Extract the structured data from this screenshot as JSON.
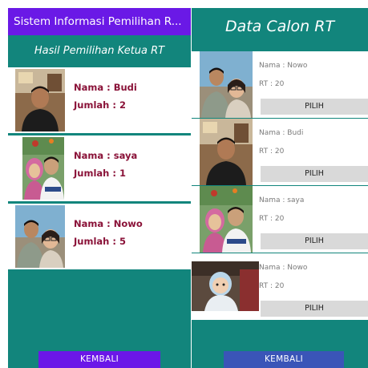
{
  "left_screen": {
    "appbar_title": "Sistem Informasi Pemilihan R...",
    "subtitle": "Hasil Pemilihan Ketua RT",
    "results": [
      {
        "nama": "Nama : Budi",
        "jumlah": "Jumlah : 2"
      },
      {
        "nama": "Nama : saya",
        "jumlah": "Jumlah : 1"
      },
      {
        "nama": "Nama : Nowo",
        "jumlah": "Jumlah : 5"
      }
    ],
    "back_button": "KEMBALI"
  },
  "right_screen": {
    "title": "Data Calon RT",
    "candidates": [
      {
        "nama": "Nama : Nowo",
        "rt": "RT : 20",
        "button": "PILIH"
      },
      {
        "nama": "Nama : Budi",
        "rt": "RT : 20",
        "button": "PILIH"
      },
      {
        "nama": "Nama : saya",
        "rt": "RT : 20",
        "button": "PILIH"
      },
      {
        "nama": "Nama : Nowo",
        "rt": "RT : 20",
        "button": "PILIH"
      }
    ],
    "back_button": "KEMBALI"
  },
  "colors": {
    "teal_background": "#12857c",
    "purple_appbar": "#6a19e6",
    "name_text": "#8a1238",
    "pilih_button": "#d9d9d9",
    "kembali_right": "#3a55b8"
  }
}
